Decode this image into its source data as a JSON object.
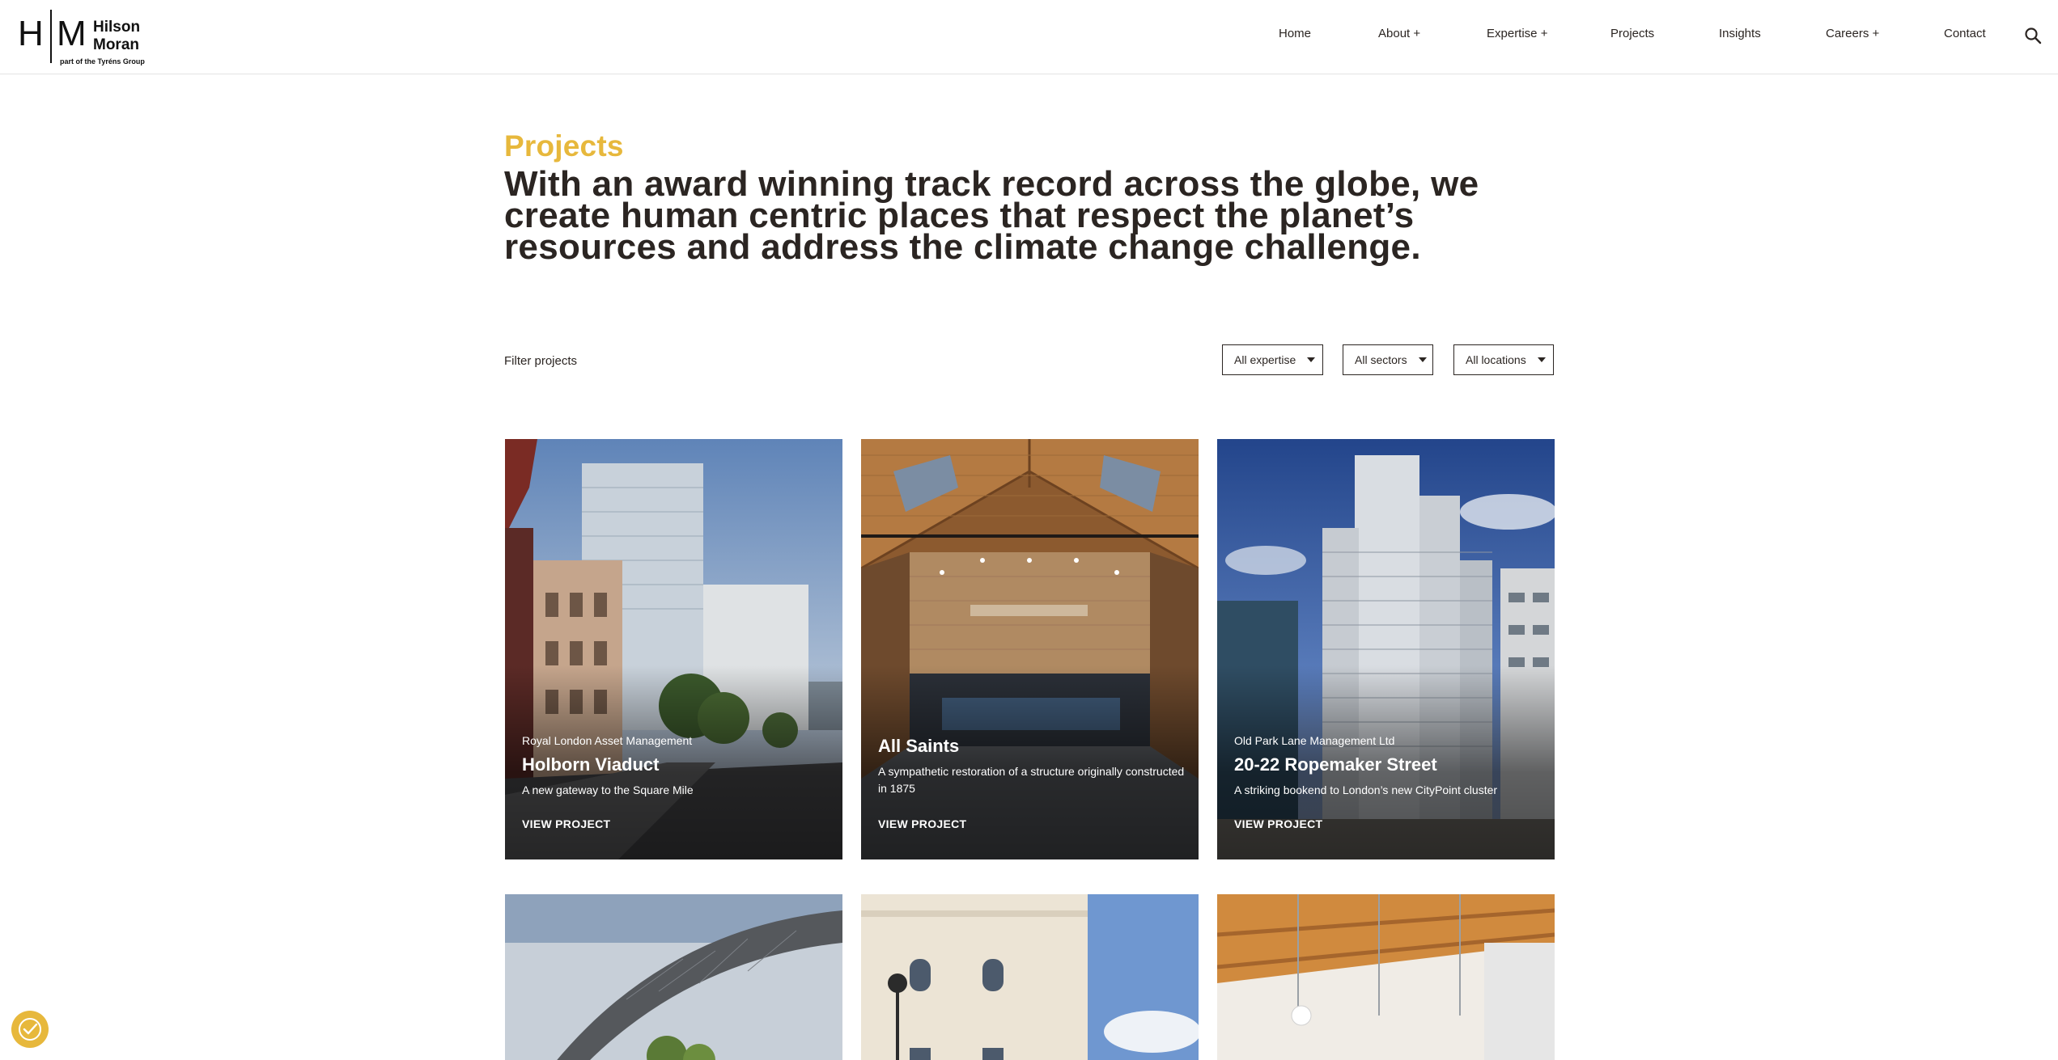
{
  "header": {
    "logo": {
      "mark_left": "H",
      "mark_right": "M",
      "name_line1": "Hilson",
      "name_line2": "Moran",
      "tagline": "part of the Tyréns Group"
    },
    "nav": [
      {
        "label": "Home"
      },
      {
        "label": "About +"
      },
      {
        "label": "Expertise +"
      },
      {
        "label": "Projects"
      },
      {
        "label": "Insights"
      },
      {
        "label": "Careers +"
      },
      {
        "label": "Contact"
      }
    ],
    "search_icon": "search-icon"
  },
  "intro": {
    "eyebrow": "Projects",
    "headline": "With an award winning track record across the globe, we create human centric places that respect the planet’s resources and address the climate change challenge."
  },
  "filters": {
    "label": "Filter projects",
    "expertise": "All expertise",
    "sectors": "All sectors",
    "locations": "All locations"
  },
  "projects": [
    {
      "client": "Royal London Asset Management",
      "title": "Holborn Viaduct",
      "description": "A new gateway to the Square Mile",
      "cta": "VIEW PROJECT"
    },
    {
      "client": "",
      "title": "All Saints",
      "description": "A sympathetic restoration of a structure originally constructed in 1875",
      "cta": "VIEW PROJECT"
    },
    {
      "client": "Old Park Lane Management Ltd",
      "title": "20-22 Ropemaker Street",
      "description": "A striking bookend to London’s new CityPoint cluster",
      "cta": "VIEW PROJECT"
    }
  ],
  "colors": {
    "accent": "#e7b83c",
    "text": "#2b2522"
  }
}
